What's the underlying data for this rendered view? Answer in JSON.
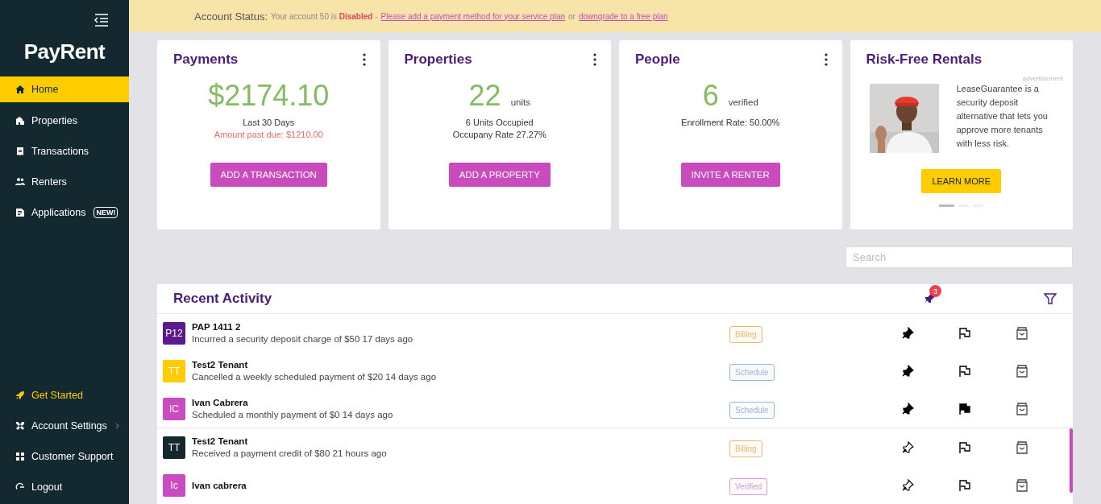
{
  "sidebar": {
    "logo": "PayRent",
    "items": [
      {
        "label": "Home",
        "selected": true
      },
      {
        "label": "Properties",
        "selected": false
      },
      {
        "label": "Transactions",
        "selected": false
      },
      {
        "label": "Renters",
        "selected": false
      },
      {
        "label": "Applications",
        "selected": false,
        "badge": "NEW!"
      }
    ],
    "bottom_items": [
      {
        "label": "Get Started",
        "kind": "accent"
      },
      {
        "label": "Account Settings",
        "kind": "submenu"
      },
      {
        "label": "Customer Support",
        "kind": "plain"
      },
      {
        "label": "Logout",
        "kind": "plain"
      }
    ]
  },
  "banner": {
    "label": "Account Status:",
    "text_before": "Your account 50 is",
    "status": "Disabled",
    "separator": "-",
    "link_1": "Please add a payment method for your service plan",
    "joiner": "or",
    "link_2": "downgrade to a free plan"
  },
  "cards": [
    {
      "title": "Payments",
      "value": "$2174.10",
      "lines": [
        {
          "text": "Last 30 Days",
          "kind": "normal"
        },
        {
          "text": "Amount past due: $1210.00",
          "kind": "alert"
        }
      ],
      "button": "ADD A TRANSACTION"
    },
    {
      "title": "Properties",
      "value": "22",
      "unit": "units",
      "lines": [
        {
          "text": "6 Units Occupied",
          "kind": "normal"
        },
        {
          "text": "Occupany Rate 27.27%",
          "kind": "normal"
        }
      ],
      "button": "ADD A PROPERTY"
    },
    {
      "title": "People",
      "value": "6",
      "unit": "verified",
      "lines": [
        {
          "text": "Enrollment Rate: 50.00%",
          "kind": "normal"
        }
      ],
      "button": "INVITE A RENTER"
    }
  ],
  "ad": {
    "title": "Risk-Free Rentals",
    "tag": "advertisement",
    "text": "LeaseGuarantee is a security deposit alternative that lets you approve more tenants with less risk.",
    "button": "LEARN MORE",
    "slides": [
      {
        "selected": true
      },
      {
        "selected": false
      },
      {
        "selected": false
      }
    ]
  },
  "search": {
    "placeholder": "Search"
  },
  "activity": {
    "title": "Recent Activity",
    "pinned_count": "3",
    "rows": [
      {
        "initials": "P12",
        "color": "#5b1a8c",
        "name": "PAP 1411 2",
        "text": "Incurred a security deposit charge of $50 17 days ago",
        "tag": {
          "label": "Billing",
          "color": "#f0b86a"
        },
        "pinned": true,
        "flagged": false
      },
      {
        "initials": "TT",
        "color": "#ffcc00",
        "name": "Test2 Tenant",
        "text": "Cancelled a weekly scheduled payment of $20 14 days ago",
        "tag": {
          "label": "Schedule",
          "color": "#8fb8ec"
        },
        "pinned": true,
        "flagged": false
      },
      {
        "initials": "IC",
        "color": "#c94bbd",
        "name": "Ivan Cabrera",
        "text": "Scheduled a monthly payment of $0 14 days ago",
        "tag": {
          "label": "Schedule",
          "color": "#8fb8ec"
        },
        "pinned": true,
        "flagged": true
      },
      {
        "initials": "TT",
        "color": "#14282f",
        "name": "Test2 Tenant",
        "text": "Received a payment credit of $80 21 hours ago",
        "tag": {
          "label": "Billing",
          "color": "#f0b86a"
        },
        "pinned": false,
        "flagged": false
      },
      {
        "initials": "Ic",
        "color": "#c94bbd",
        "name": "Ivan cabrera",
        "tag": {
          "label": "Verified",
          "color": "#d29be8"
        },
        "pinned": false,
        "flagged": false
      }
    ]
  }
}
